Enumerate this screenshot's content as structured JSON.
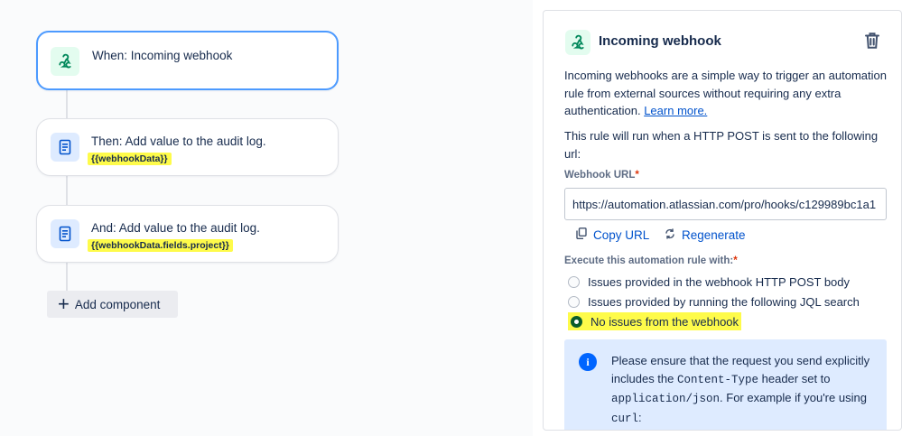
{
  "canvas": {
    "trigger": {
      "title": "When: Incoming webhook",
      "icon": "webhook-icon"
    },
    "actions": [
      {
        "title": "Then: Add value to the audit log.",
        "code": "{{webhookData}}",
        "icon": "document-icon"
      },
      {
        "title": "And: Add value to the audit log.",
        "code": "{{webhookData.fields.project}}",
        "icon": "document-icon"
      }
    ],
    "add_component_label": "Add component"
  },
  "panel": {
    "title": "Incoming webhook",
    "icon": "webhook-icon",
    "delete_icon": "trash-icon",
    "description": "Incoming webhooks are a simple way to trigger an automation rule from external sources without requiring any extra authentication.",
    "learn_more": "Learn more.",
    "rule_text": "This rule will run when a HTTP POST is sent to the following url:",
    "webhook_url_label": "Webhook URL",
    "required_mark": "*",
    "webhook_url_value": "https://automation.atlassian.com/pro/hooks/c129989bc1a1",
    "copy_url": "Copy URL",
    "regenerate": "Regenerate",
    "execute_label": "Execute this automation rule with:",
    "options": [
      {
        "label": "Issues provided in the webhook HTTP POST body",
        "checked": false
      },
      {
        "label": "Issues provided by running the following JQL search",
        "checked": false
      },
      {
        "label": "No issues from the webhook",
        "checked": true
      }
    ],
    "info": {
      "part1": "Please ensure that the request you send explicitly includes the ",
      "code1": "Content-Type",
      "part2": " header set to ",
      "code2": "application/json",
      "part3": ". For example if you're using ",
      "code3": "curl",
      "part4": ":"
    }
  },
  "colors": {
    "accent": "#0052cc",
    "selected_border": "#4c9aff",
    "highlight": "#fefb4a",
    "info_bg": "#deebff"
  }
}
